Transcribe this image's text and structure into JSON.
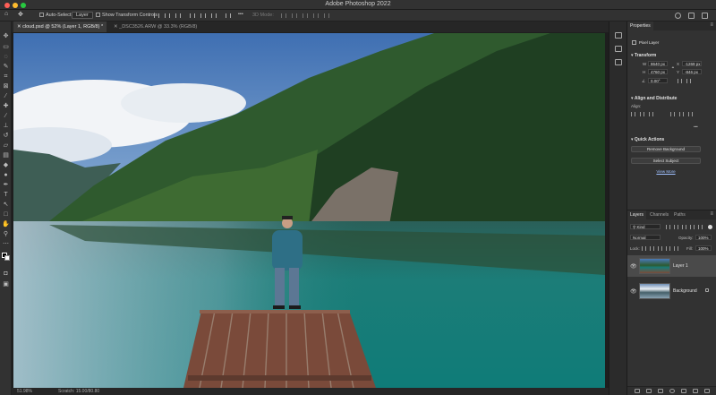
{
  "app": {
    "title": "Adobe Photoshop 2022"
  },
  "colors": {
    "accent": "#1473e6",
    "traffic_red": "#ff5f57",
    "traffic_yellow": "#febc2e",
    "traffic_green": "#28c840"
  },
  "options": {
    "auto_select_label": "Auto-Select:",
    "auto_select_value": "Layer",
    "show_transform_label": "Show Transform Controls",
    "mode_3d": "3D Mode:"
  },
  "tabs": [
    {
      "label": "cloud.psd @ 52% (Layer 1, RGB/8) *",
      "active": true
    },
    {
      "label": "_DSC3526.ARW @ 33.3% (RGB/8)",
      "active": false
    }
  ],
  "status": {
    "zoom": "51.98%",
    "scratch": "Scratch: 15.00/80.80"
  },
  "properties": {
    "tab": "Properties",
    "kind": "Pixel Layer",
    "transform_title": "Transform",
    "w_label": "W",
    "w": "8640 px",
    "x_label": "X",
    "x": "-1269 px",
    "h_label": "H",
    "h": "4760 px",
    "y_label": "Y",
    "y": "-846 px",
    "angle": "0.00°",
    "align_title": "Align and Distribute",
    "align_label": "Align:",
    "more": "•••",
    "quick_title": "Quick Actions",
    "remove_bg": "Remove Background",
    "select_subject": "Select Subject",
    "view_more": "View More"
  },
  "layers": {
    "tabs": [
      "Layers",
      "Channels",
      "Paths"
    ],
    "kind": "Kind",
    "blend": "Normal",
    "opacity_label": "Opacity:",
    "opacity": "100%",
    "lock_label": "Lock:",
    "fill_label": "Fill:",
    "fill": "100%",
    "items": [
      {
        "name": "Layer 1",
        "selected": true
      },
      {
        "name": "Background",
        "selected": false
      }
    ]
  }
}
